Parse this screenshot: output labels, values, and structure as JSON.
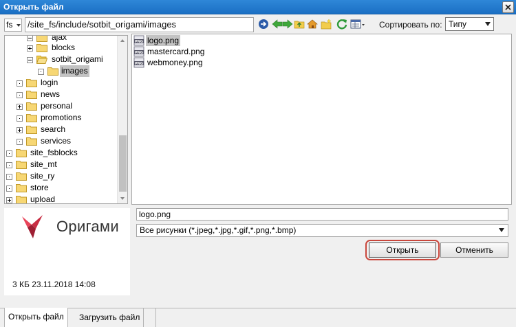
{
  "window": {
    "title": "Открыть файл",
    "close_icon": "close-icon"
  },
  "toolbar": {
    "site_selector": "fs",
    "path": "/site_fs/include/sotbit_origami/images",
    "icons": [
      "go-icon",
      "back-icon",
      "forward-icon",
      "up-folder-icon",
      "home-icon",
      "new-folder-icon",
      "refresh-icon",
      "view-mode-icon"
    ],
    "sort_label": "Сортировать по:",
    "sort_value": "Типу"
  },
  "tree": {
    "items": [
      {
        "label": "ajax"
      },
      {
        "label": "blocks"
      },
      {
        "label": "sotbit_origami"
      },
      {
        "label": "images",
        "selected": true
      },
      {
        "label": "login"
      },
      {
        "label": "news"
      },
      {
        "label": "personal"
      },
      {
        "label": "promotions"
      },
      {
        "label": "search"
      },
      {
        "label": "services"
      },
      {
        "label": "site_fsblocks"
      },
      {
        "label": "site_mt"
      },
      {
        "label": "site_ry"
      },
      {
        "label": "store"
      },
      {
        "label": "upload"
      }
    ]
  },
  "files": {
    "items": [
      {
        "name": "logo.png",
        "selected": true
      },
      {
        "name": "mastercard.png"
      },
      {
        "name": "webmoney.png"
      }
    ]
  },
  "preview": {
    "logo_text": "Оригами",
    "info": "3 КБ 23.11.2018 14:08"
  },
  "form": {
    "filename": "logo.png",
    "filter": "Все рисунки (*.jpeg,*.jpg,*.gif,*.png,*.bmp)",
    "open_label": "Открыть",
    "cancel_label": "Отменить"
  },
  "tabs": {
    "open": "Открыть файл",
    "upload": "Загрузить файл"
  },
  "colors": {
    "titlebar": "#2f87d8",
    "highlight": "#c9473c",
    "selection": "#c3c3c3",
    "folder": "#f7d774"
  }
}
